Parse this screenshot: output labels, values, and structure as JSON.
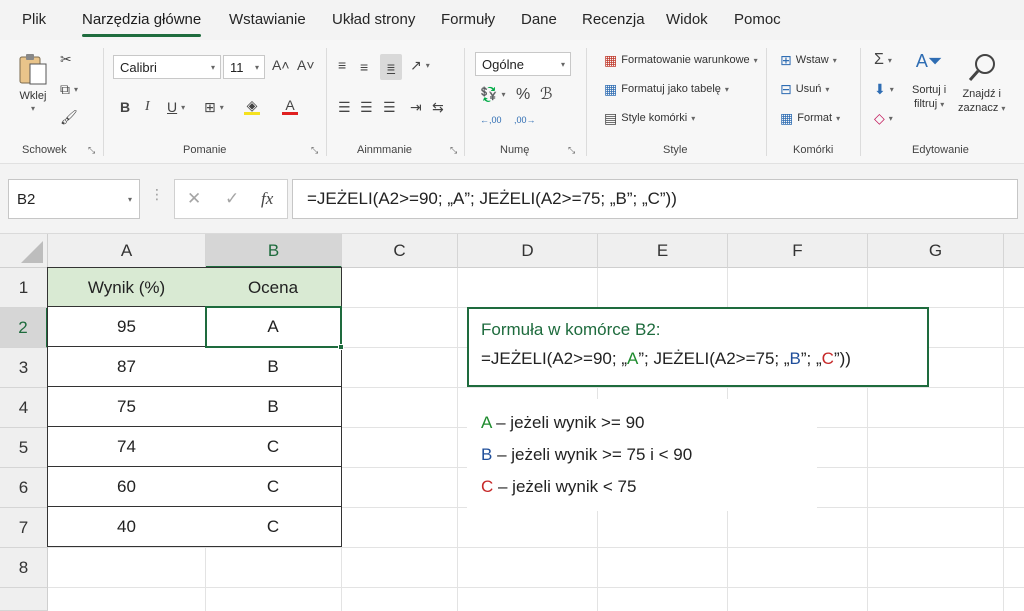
{
  "menu": {
    "tabs": [
      "Plik",
      "Narzędzia główne",
      "Wstawianie",
      "Układ strony",
      "Formuły",
      "Dane",
      "Recenzja",
      "Widok",
      "Pomoc"
    ],
    "active_tab": "Narzędzia główne"
  },
  "ribbon": {
    "clipboard": {
      "paste_label": "Wklej",
      "group_label": "Schowek"
    },
    "font": {
      "name": "Calibri",
      "size": "11",
      "group_label": "Pomanie"
    },
    "alignment": {
      "group_label": "Ainmmanie"
    },
    "number": {
      "format": "Ogólne",
      "group_label": "Numę"
    },
    "styles": {
      "conditional": "Formatowanie warunkowe",
      "table": "Formatuj jako tabelę",
      "cell_styles": "Style komórki",
      "group_label": "Style"
    },
    "cells": {
      "insert": "Wstaw",
      "delete": "Usuń",
      "format": "Format",
      "group_label": "Komórki"
    },
    "editing": {
      "sort_line1": "Sortuj i",
      "sort_line2": "filtruj",
      "find_line1": "Znajdź i",
      "find_line2": "zaznacz",
      "group_label": "Edytowanie"
    }
  },
  "formula_bar": {
    "name_box": "B2",
    "formula": "=JEŻELI(A2>=90; „A”; JEŻELI(A2>=75; „B”; „C”))"
  },
  "sheet": {
    "columns": [
      "A",
      "B",
      "C",
      "D",
      "E",
      "F",
      "G"
    ],
    "rows": [
      "1",
      "2",
      "3",
      "4",
      "5",
      "6",
      "7",
      "8"
    ],
    "header_a": "Wynik (%)",
    "header_b": "Ocena",
    "data": [
      {
        "score": "95",
        "grade": "A"
      },
      {
        "score": "87",
        "grade": "B"
      },
      {
        "score": "75",
        "grade": "B"
      },
      {
        "score": "74",
        "grade": "C"
      },
      {
        "score": "60",
        "grade": "C"
      },
      {
        "score": "40",
        "grade": "C"
      }
    ]
  },
  "info_box": {
    "title": "Formuła w komórce B2:",
    "f_prefix": "=JEŻELI(A2>=90; „",
    "f_a": "A",
    "f_mid1": "”; JEŻELI(A2>=75; „",
    "f_b": "B",
    "f_mid2": "”;  „",
    "f_c": "C",
    "f_suffix": "”))"
  },
  "legend": {
    "a_letter": "A",
    "a_text": " – jeżeli wynik >= 90",
    "b_letter": "B",
    "b_text": " – jeżeli wynik >= 75 i < 90",
    "c_letter": "C",
    "c_text": " – jeżeli wynik < 75"
  },
  "colors": {
    "accent": "#1e6b3d",
    "header_fill": "#d9ead3",
    "grade_a": "#1e8b2e",
    "grade_b": "#1f4e9a",
    "grade_c": "#c62828"
  }
}
